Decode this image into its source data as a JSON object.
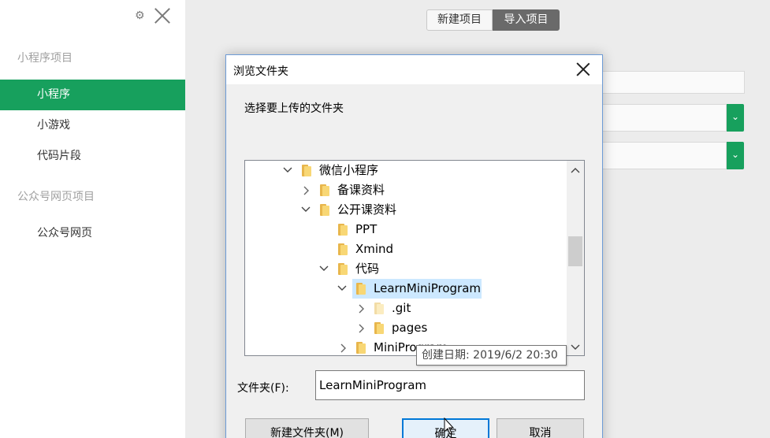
{
  "sidebar": {
    "section1_title": "小程序项目",
    "items": [
      {
        "label": "小程序",
        "active": true
      },
      {
        "label": "小游戏",
        "active": false
      },
      {
        "label": "代码片段",
        "active": false
      }
    ],
    "section2_title": "公众号网页项目",
    "items2": [
      {
        "label": "公众号网页"
      }
    ]
  },
  "header": {
    "new_project": "新建项目",
    "import_project": "导入项目"
  },
  "dialog": {
    "title": "浏览文件夹",
    "description": "选择要上传的文件夹",
    "tree": [
      {
        "label": "微信小程序",
        "expanded": true
      },
      {
        "label": "备课资料",
        "expanded": false
      },
      {
        "label": "公开课资料",
        "expanded": true
      },
      {
        "label": "PPT"
      },
      {
        "label": "Xmind"
      },
      {
        "label": "代码",
        "expanded": true
      },
      {
        "label": "LearnMiniProgram",
        "expanded": true,
        "selected": true
      },
      {
        "label": ".git",
        "expanded": false
      },
      {
        "label": "pages",
        "expanded": false
      },
      {
        "label": "MiniProgram",
        "expanded": false
      }
    ],
    "tooltip": "创建日期: 2019/6/2 20:30",
    "folder_label": "文件夹(F):",
    "folder_value": "LearnMiniProgram",
    "new_folder_button": "新建文件夹(M)",
    "ok_button": "确定",
    "cancel_button": "取消"
  },
  "colors": {
    "accent": "#17a05d",
    "selection": "#cce8ff",
    "primary_button_border": "#0078d7"
  }
}
